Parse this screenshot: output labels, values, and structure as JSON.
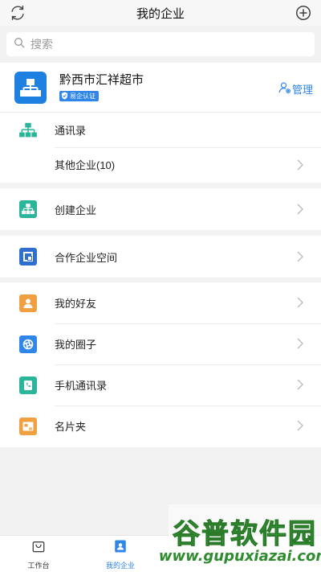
{
  "header": {
    "title": "我的企业",
    "refresh_icon": "refresh-icon",
    "add_icon": "add-circle-icon"
  },
  "search": {
    "placeholder": "搜索"
  },
  "company": {
    "name": "黔西市汇祥超市",
    "badge": "易企认证",
    "manage_label": "管理"
  },
  "company_section": {
    "items": [
      {
        "label": "通讯录",
        "icon": "org-chart-icon"
      },
      {
        "label": "其他企业(10)"
      }
    ]
  },
  "create": {
    "label": "创建企业",
    "icon": "org-chart-icon"
  },
  "partner": {
    "label": "合作企业空间",
    "icon": "building-icon"
  },
  "social": {
    "items": [
      {
        "label": "我的好友",
        "icon": "person-icon",
        "color": "#f0a040"
      },
      {
        "label": "我的圈子",
        "icon": "aperture-icon",
        "color": "#2f86e8"
      },
      {
        "label": "手机通讯录",
        "icon": "phone-book-icon",
        "color": "#2bb59a"
      },
      {
        "label": "名片夹",
        "icon": "card-icon",
        "color": "#f0a040"
      }
    ]
  },
  "tabs": [
    {
      "label": "工作台",
      "icon": "bag-icon",
      "active": false
    },
    {
      "label": "我的企业",
      "icon": "contacts-icon",
      "active": true
    }
  ],
  "watermark": {
    "big": "谷普软件园",
    "small": "www.gupuxiazai.com"
  },
  "colors": {
    "accent": "#2f86e8",
    "teal": "#2bb59a",
    "orange": "#f0a040",
    "background": "#f2f2f2"
  }
}
